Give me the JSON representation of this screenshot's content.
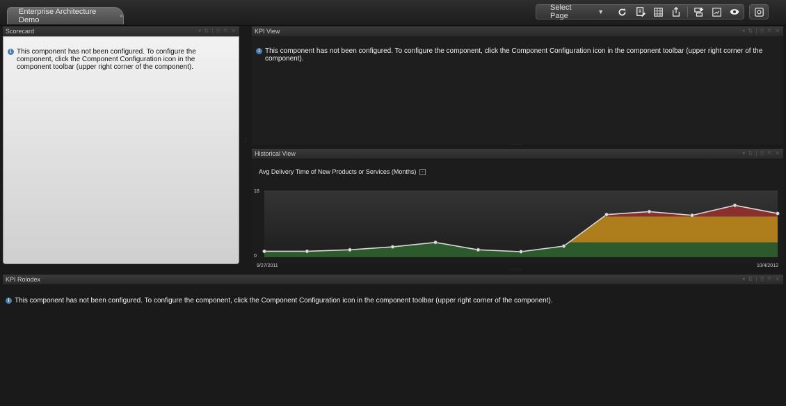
{
  "tab": {
    "label": "Enterprise Architecture Demo",
    "close": "×"
  },
  "toolbar": {
    "select_page_label": "Select Page",
    "caret": "▼",
    "icons": [
      "refresh-icon",
      "save-page-icon",
      "layout-icon",
      "export-icon",
      "component-gallery-icon",
      "page-properties-icon",
      "preview-icon",
      "settings-icon"
    ]
  },
  "panels": {
    "scorecard": {
      "title": "Scorecard",
      "tools": "▾ ⇅ | ⎘ ⇱ ✕"
    },
    "kpi_view": {
      "title": "KPI View",
      "tools": "▾ ⇅ | ⎘ ⇱ ✕"
    },
    "historical_view": {
      "title": "Historical View",
      "tools": "▾ ⇅ | ⎘ ⇱ ✕"
    },
    "kpi_rolodex": {
      "title": "KPI Rolodex",
      "tools": "▾ ⇅ | ⎘ ⇱ ✕"
    }
  },
  "messages": {
    "not_configured": "This component has not been configured. To configure the component, click the Component Configuration icon in the component toolbar (upper right corner of the component)."
  },
  "metric": {
    "title": "Avg Delivery Time of New Products or Services (Months)",
    "toggle": "-"
  },
  "chart_data": {
    "type": "area",
    "title": "Avg Delivery Time of New Products or Services (Months)",
    "x_start_label": "9/27/2011",
    "x_end_label": "10/4/2012",
    "y_tick_labels": [
      "0",
      "18"
    ],
    "ylim": [
      0,
      18
    ],
    "grid": false,
    "series": [
      {
        "values": [
          1.6,
          1.6,
          2.0,
          2.8,
          4.0,
          2.0,
          1.5,
          3.0,
          11.5,
          12.3,
          11.3,
          14.0,
          11.8
        ]
      }
    ],
    "threshold_bands": [
      {
        "from": 0,
        "to": 4,
        "color": "#2e5e2e"
      },
      {
        "from": 4,
        "to": 11,
        "color": "#b5831c"
      },
      {
        "from": 11,
        "to": 18,
        "color": "#8e2f2f"
      }
    ],
    "colors": {
      "line": "#d8d8d8",
      "marker": "#e0e0e0",
      "plot_bg": "#262626"
    }
  }
}
